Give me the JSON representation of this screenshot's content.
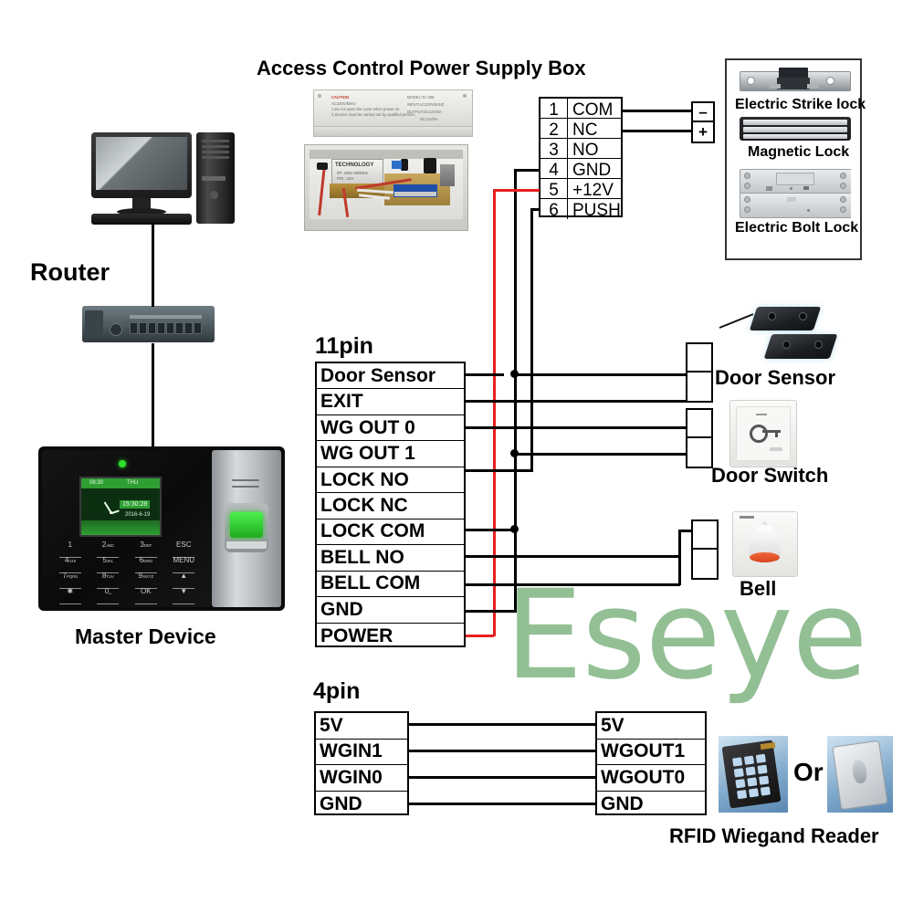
{
  "diagram": {
    "title_power_box": "Access Control Power Supply Box",
    "watermark": "Eseye",
    "or_label": "Or"
  },
  "labels": {
    "router": "Router",
    "master_device": "Master Device",
    "pin11": "11pin",
    "pin4": "4pin",
    "door_sensor": "Door Sensor",
    "door_switch": "Door Switch",
    "bell": "Bell",
    "rfid_reader": "RFID Wiegand Reader"
  },
  "power_terminal": {
    "rows": [
      {
        "num": "1",
        "label": "COM"
      },
      {
        "num": "2",
        "label": "NC"
      },
      {
        "num": "3",
        "label": "NO"
      },
      {
        "num": "4",
        "label": "GND"
      },
      {
        "num": "5",
        "label": "+12V"
      },
      {
        "num": "6",
        "label": "PUSH"
      }
    ]
  },
  "lock_connector": {
    "cells": [
      "–",
      "+"
    ]
  },
  "lock_panel": {
    "items": [
      {
        "name": "Electric Strike lock"
      },
      {
        "name": "Magnetic Lock"
      },
      {
        "name": "Electric Bolt Lock"
      }
    ]
  },
  "terminal_11pin": {
    "rows": [
      "Door Sensor",
      "EXIT",
      "WG OUT 0",
      "WG OUT 1",
      "LOCK NO",
      "LOCK NC",
      "LOCK COM",
      "BELL NO",
      "BELL COM",
      "GND",
      "POWER"
    ]
  },
  "terminal_4pin_left": {
    "rows": [
      "5V",
      "WGIN1",
      "WGIN0",
      "GND"
    ]
  },
  "terminal_4pin_right": {
    "rows": [
      "5V",
      "WGOUT1",
      "WGOUT0",
      "GND"
    ]
  },
  "psu_box_text": {
    "caution": "CAUTION",
    "model": "MODEL:TA-208",
    "input": "INPUT:AC220V/50HZ",
    "output1": "OUTPUT:DC12V/5A",
    "output2": "DC12V/5A",
    "brand": "TECHNOLOGY",
    "spec1": "I/P: 220V  50/60Hz",
    "spec2": "P/O : 12V"
  },
  "master_device_ui": {
    "screen_left": "08:30",
    "screen_right": "THU",
    "time": "15:30:28",
    "date": "2016-6-19",
    "keys": [
      {
        "main": "1",
        "sub": ""
      },
      {
        "main": "2",
        "sub": "ABC"
      },
      {
        "main": "3",
        "sub": "DEF"
      },
      {
        "main": "ESC",
        "sub": ""
      },
      {
        "main": "4",
        "sub": "GHI"
      },
      {
        "main": "5",
        "sub": "JKL"
      },
      {
        "main": "6",
        "sub": "MNO"
      },
      {
        "main": "MENU",
        "sub": ""
      },
      {
        "main": "7",
        "sub": "PQRS"
      },
      {
        "main": "8",
        "sub": "TUV"
      },
      {
        "main": "9",
        "sub": "WXYZ"
      },
      {
        "main": "▲",
        "sub": ""
      },
      {
        "main": "✱",
        "sub": ""
      },
      {
        "main": "0",
        "sub": "␣"
      },
      {
        "main": "OK",
        "sub": ""
      },
      {
        "main": "▼",
        "sub": ""
      }
    ]
  },
  "colors": {
    "wire_black": "#000000",
    "wire_red": "#e8201f",
    "watermark": "#93bf95"
  }
}
